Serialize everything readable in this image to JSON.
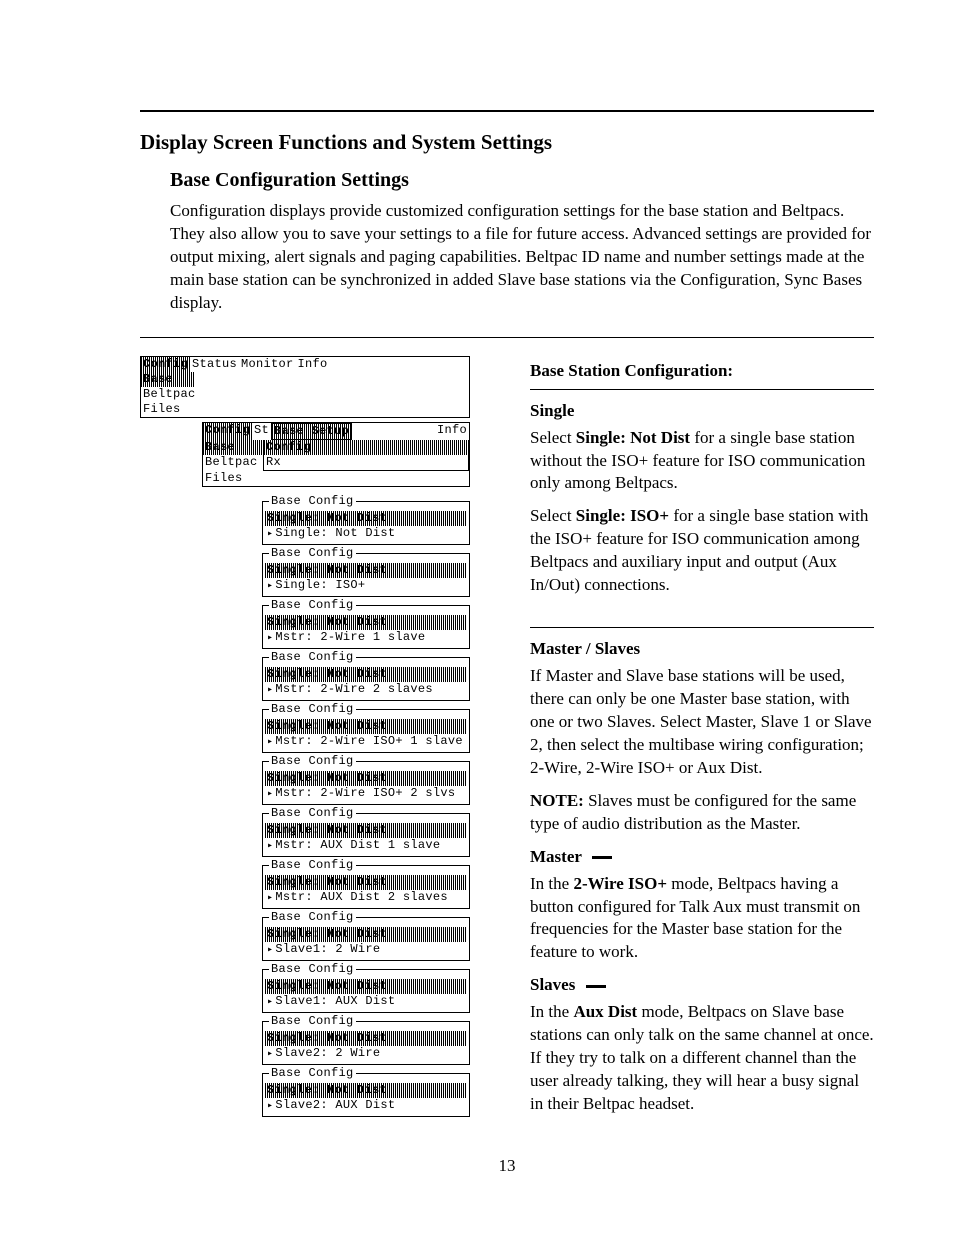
{
  "page_number": "13",
  "heading": "Display Screen Functions and System Settings",
  "subheading": "Base Configuration Settings",
  "intro": "Configuration displays provide customized configuration settings for the base station and Beltpacs.  They also allow you to save your settings to a file for future access.  Advanced settings are provided for output mixing, alert signals and paging capabilities.  Beltpac ID name and number settings made at the main base station can be synchronized in added Slave base stations via the Configuration, Sync Bases display.",
  "right": {
    "bsc_head": "Base Station Configuration:",
    "single_head": "Single",
    "single_p1a": "Select ",
    "single_p1b": "Single: Not Dist",
    "single_p1c": " for a single base station without the ISO+ feature for ISO communication only among Beltpacs.",
    "single_p2a": "Select ",
    "single_p2b": "Single: ISO+",
    "single_p2c": " for a single base station with the ISO+ feature for ISO communication among Beltpacs and auxiliary input and output (Aux In/Out) connections.",
    "ms_head": "Master / Slaves",
    "ms_p1": "If Master and Slave base stations will be used, there can only be one Master base station, with one or two Slaves.  Select Master, Slave 1 or Slave 2, then select the multibase wiring configuration; 2-Wire, 2-Wire ISO+ or Aux Dist.",
    "ms_note_b": "NOTE:",
    "ms_note_t": "  Slaves must be configured for the same type of audio distribution as the Master.",
    "master_label": "Master",
    "master_p_a": "In the ",
    "master_p_b": "2-Wire ISO+",
    "master_p_c": " mode, Beltpacs having a button configured for Talk Aux must transmit on frequencies for the Master base station for the feature to work.",
    "slaves_label": "Slaves",
    "slaves_p_a": "In the ",
    "slaves_p_b": "Aux Dist",
    "slaves_p_c": " mode, Beltpacs on Slave base stations can only talk on the same channel at once.  If they try to talk on a different channel than the user already talking, they will hear a busy signal in their Beltpac headset."
  },
  "menus": {
    "top_tabs": [
      "Config",
      "Status",
      "Monitor",
      "Info"
    ],
    "top_items": [
      "Base",
      "Beltpac",
      "Files"
    ],
    "sub_tabs_left": "Config",
    "sub_tabs_right": "Info",
    "sub_title_box": "Base Setup",
    "sub_items_left": [
      "Base",
      "Beltpac",
      "Files"
    ],
    "sub_items_right": [
      "Config",
      "Rx"
    ]
  },
  "config_title": "Base Config",
  "config_hl": "Single: Not Dist",
  "config_options": [
    "Single: Not Dist",
    "Single: ISO+",
    "Mstr: 2-Wire 1 slave",
    "Mstr: 2-Wire 2 slaves",
    "Mstr: 2-Wire ISO+ 1 slave",
    "Mstr: 2-Wire ISO+ 2 slvs",
    "Mstr: AUX Dist 1 slave",
    "Mstr: AUX Dist 2 slaves",
    "Slave1: 2 Wire",
    "Slave1: AUX Dist",
    "Slave2: 2 Wire",
    "Slave2: AUX Dist"
  ]
}
